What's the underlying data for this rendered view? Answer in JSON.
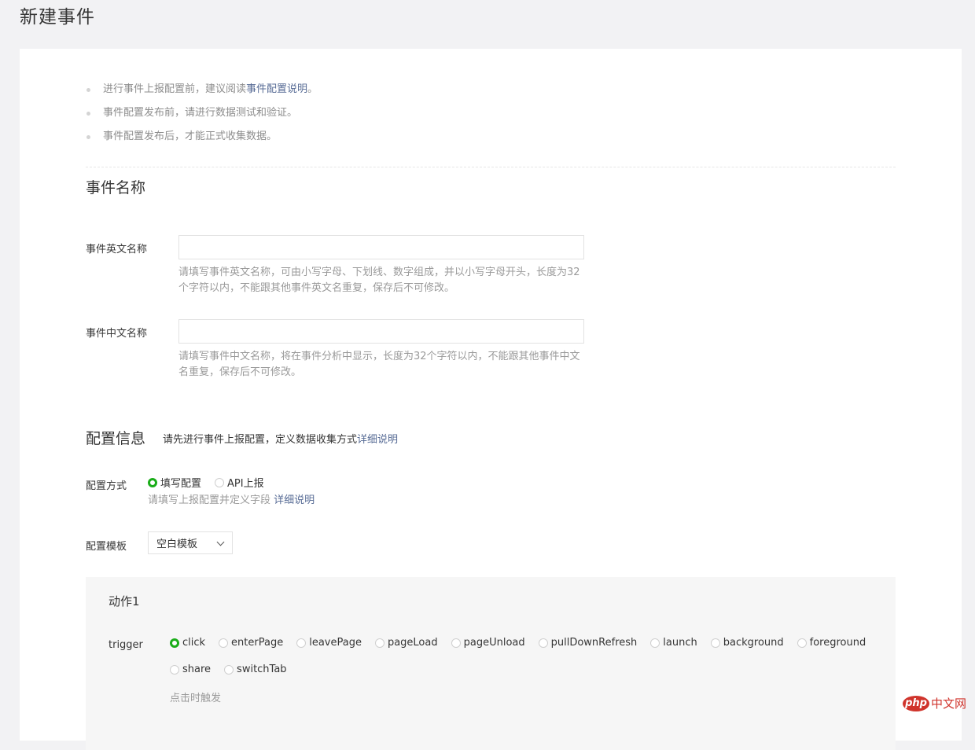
{
  "page": {
    "title": "新建事件"
  },
  "notes": {
    "item1_prefix": "进行事件上报配置前，建议阅读",
    "item1_link": "事件配置说明",
    "item1_suffix": "。",
    "item2": "事件配置发布前，请进行数据测试和验证。",
    "item3": "事件配置发布后，才能正式收集数据。"
  },
  "event_name": {
    "section_title": "事件名称",
    "english_label": "事件英文名称",
    "english_value": "",
    "english_hint": "请填写事件英文名称，可由小写字母、下划线、数字组成，并以小写字母开头，长度为32个字符以内，不能跟其他事件英文名重复，保存后不可修改。",
    "chinese_label": "事件中文名称",
    "chinese_value": "",
    "chinese_hint": "请填写事件中文名称，将在事件分析中显示，长度为32个字符以内，不能跟其他事件中文名重复，保存后不可修改。"
  },
  "config": {
    "section_title": "配置信息",
    "desc_prefix": "请先进行事件上报配置，定义数据收集方式",
    "desc_link": "详细说明",
    "method_label": "配置方式",
    "method_options": [
      "填写配置",
      "API上报"
    ],
    "method_selected": "填写配置",
    "method_hint": "请填写上报配置并定义字段",
    "method_hint_link": "详细说明",
    "template_label": "配置模板",
    "template_value": "空白模板"
  },
  "action": {
    "title": "动作1",
    "trigger_label": "trigger",
    "trigger_options": [
      "click",
      "enterPage",
      "leavePage",
      "pageLoad",
      "pageUnload",
      "pullDownRefresh",
      "launch",
      "background",
      "foreground",
      "share",
      "switchTab"
    ],
    "trigger_selected": "click",
    "trigger_hint": "点击时触发"
  },
  "watermark": {
    "php": "php",
    "text": "中文网"
  },
  "colors": {
    "accent_green": "#1aad19",
    "link": "#576b95",
    "watermark_red": "#d0342c"
  }
}
